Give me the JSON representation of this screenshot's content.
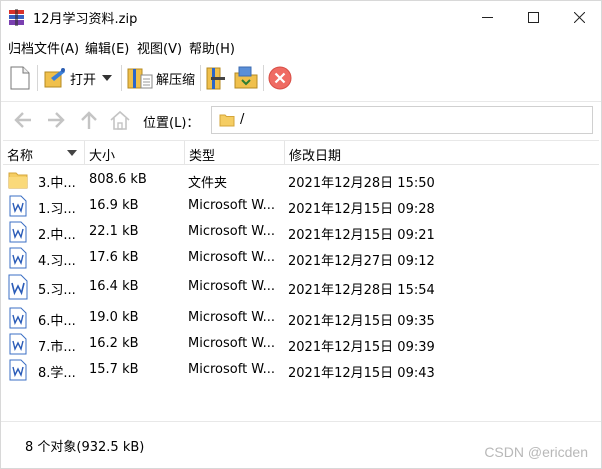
{
  "window": {
    "title": "12月学习资料.zip",
    "minimize_icon": "minimize-icon",
    "maximize_icon": "maximize-icon",
    "close_icon": "close-icon"
  },
  "menu": [
    {
      "label": "归档文件(A)"
    },
    {
      "label": "编辑(E)"
    },
    {
      "label": "视图(V)"
    },
    {
      "label": "帮助(H)"
    }
  ],
  "toolbar": {
    "new_icon": "new-archive-icon",
    "open_label": "打开",
    "extract_label": "解压缩",
    "accent_close": "#ef6b63"
  },
  "address": {
    "label": "位置(L)：",
    "path": "/"
  },
  "columns": {
    "name": "名称",
    "size": "大小",
    "type": "类型",
    "modified": "修改日期"
  },
  "files": [
    {
      "name": "3.中...",
      "size": "808.6 kB",
      "type": "文件夹",
      "modified": "2021年12月28日 15:50",
      "icon": "folder-icon"
    },
    {
      "name": "1.习...",
      "size": "16.9 kB",
      "type": "Microsoft W...",
      "modified": "2021年12月15日 09:28",
      "icon": "word-doc-icon"
    },
    {
      "name": "2.中...",
      "size": "22.1 kB",
      "type": "Microsoft W...",
      "modified": "2021年12月15日 09:21",
      "icon": "word-doc-icon"
    },
    {
      "name": "4.习...",
      "size": "17.6 kB",
      "type": "Microsoft W...",
      "modified": "2021年12月27日 09:12",
      "icon": "word-doc-icon"
    },
    {
      "name": "5.习...",
      "size": "16.4 kB",
      "type": "Microsoft W...",
      "modified": "2021年12月28日 15:54",
      "icon": "word-doc-icon"
    },
    {
      "name": "6.中...",
      "size": "19.0 kB",
      "type": "Microsoft W...",
      "modified": "2021年12月15日 09:35",
      "icon": "word-doc-icon"
    },
    {
      "name": "7.市...",
      "size": "16.2 kB",
      "type": "Microsoft W...",
      "modified": "2021年12月15日 09:39",
      "icon": "word-doc-icon"
    },
    {
      "name": "8.学...",
      "size": "15.7 kB",
      "type": "Microsoft W...",
      "modified": "2021年12月15日 09:43",
      "icon": "word-doc-icon"
    }
  ],
  "status": "8 个对象(932.5 kB)",
  "watermark": "CSDN @ericden"
}
